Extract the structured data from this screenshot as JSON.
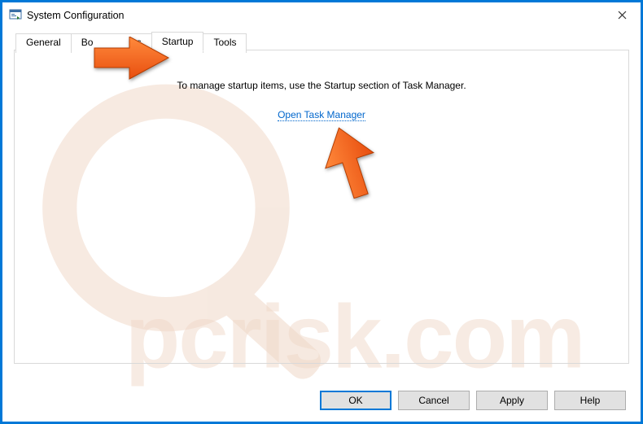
{
  "window": {
    "title": "System Configuration"
  },
  "tabs": {
    "general": "General",
    "boot": "Bo",
    "services": "es",
    "startup": "Startup",
    "tools": "Tools",
    "active": "startup"
  },
  "startup_panel": {
    "info_text": "To manage startup items, use the Startup section of Task Manager.",
    "link_text": "Open Task Manager"
  },
  "buttons": {
    "ok": "OK",
    "cancel": "Cancel",
    "apply": "Apply",
    "help": "Help"
  },
  "watermark": {
    "text": "pcrisk.com"
  }
}
